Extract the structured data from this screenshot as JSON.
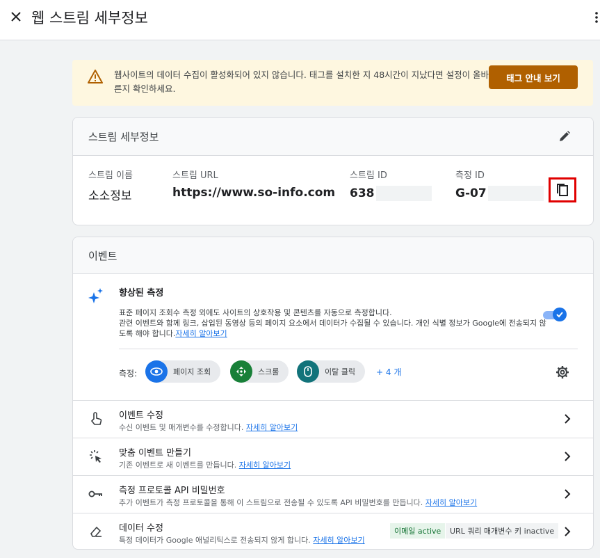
{
  "header": {
    "title": "웹 스트림 세부정보"
  },
  "banner": {
    "message": "웹사이트의 데이터 수집이 활성화되어 있지 않습니다. 태그를 설치한 지 48시간이 지났다면 설정이 올바른지 확인하세요.",
    "button": "태그 안내 보기"
  },
  "stream": {
    "heading": "스트림 세부정보",
    "name_label": "스트림 이름",
    "name": "소소정보",
    "url_label": "스트림 URL",
    "url": "https://www.so-info.com",
    "id_label": "스트림 ID",
    "id": "638",
    "mid_label": "측정 ID",
    "mid": "G-07"
  },
  "events": {
    "heading": "이벤트",
    "enhanced": {
      "title": "향상된 측정",
      "desc1": "표준 페이지 조회수 측정 외에도 사이트의 상호작용 및 콘텐츠를 자동으로 측정합니다.",
      "desc2": "관련 이벤트와 함께 링크, 삽입된 동영상 등의 페이지 요소에서 데이터가 수집될 수 있습니다. 개인 식별 정보가 Google에 전송되지 않도록 해야 합니다.",
      "learn_more": "자세히 알아보기",
      "measure_label": "측정:",
      "chips": [
        "페이지 조회",
        "스크롤",
        "이탈 클릭"
      ],
      "more": "+ 4 개"
    },
    "rows": [
      {
        "title": "이벤트 수정",
        "desc": "수신 이벤트 및 매개변수를 수정합니다.",
        "link": "자세히 알아보기"
      },
      {
        "title": "맞춤 이벤트 만들기",
        "desc": "기존 이벤트로 새 이벤트를 만듭니다.",
        "link": "자세히 알아보기"
      },
      {
        "title": "측정 프로토콜 API 비밀번호",
        "desc": "추가 이벤트가 측정 프로토콜을 통해 이 스트림으로 전송될 수 있도록 API 비밀번호를 만듭니다.",
        "link": "자세히 알아보기"
      },
      {
        "title": "데이터 수정",
        "desc": "특정 데이터가 Google 애널리틱스로 전송되지 않게 합니다.",
        "link": "자세히 알아보기",
        "tag1": "이메일 active",
        "tag2": "URL 쿼리 매개변수 키 inactive"
      }
    ]
  },
  "colors": {
    "accent": "#1a73e8",
    "warning_button": "#b06000",
    "banner_bg": "#fef7e0",
    "highlight_border": "#e00000"
  }
}
